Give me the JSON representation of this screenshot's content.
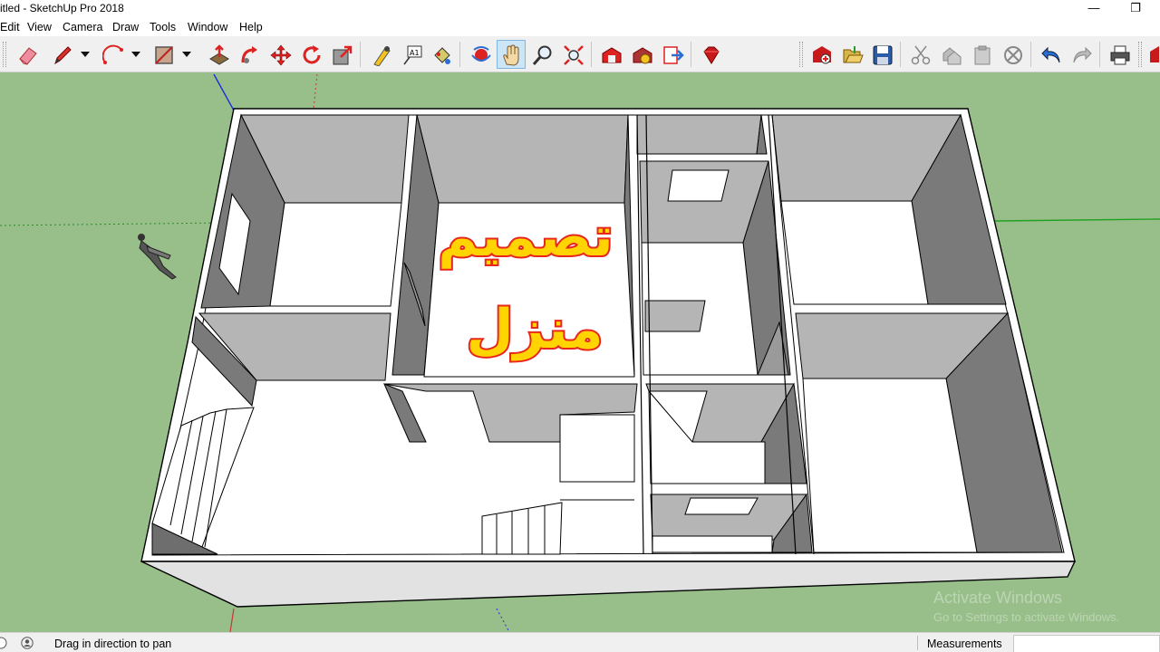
{
  "window": {
    "title": "itled - SketchUp Pro 2018",
    "minimize_glyph": "—",
    "restore_glyph": "❐"
  },
  "menu": {
    "items": [
      "Edit",
      "View",
      "Camera",
      "Draw",
      "Tools",
      "Window",
      "Help"
    ]
  },
  "toolbar": {
    "tools": [
      {
        "name": "eraser-icon"
      },
      {
        "name": "pencil-line-icon",
        "has_dropdown": true
      },
      {
        "name": "arc-icon",
        "has_dropdown": true
      },
      {
        "name": "rectangle-icon",
        "has_dropdown": true
      },
      {
        "name": "push-pull-icon"
      },
      {
        "name": "follow-me-icon"
      },
      {
        "name": "move-icon"
      },
      {
        "name": "rotate-icon"
      },
      {
        "name": "scale-icon"
      },
      {
        "name": "tape-measure-icon"
      },
      {
        "name": "text-icon",
        "label": "A1"
      },
      {
        "name": "paint-bucket-icon"
      },
      {
        "name": "orbit-icon"
      },
      {
        "name": "pan-icon",
        "active": true
      },
      {
        "name": "zoom-icon"
      },
      {
        "name": "zoom-extents-icon"
      },
      {
        "name": "warehouse-icon"
      },
      {
        "name": "extension-warehouse-icon"
      },
      {
        "name": "send-to-layout-icon"
      },
      {
        "name": "ruby-console-icon"
      },
      {
        "name": "new-file-icon"
      },
      {
        "name": "open-folder-icon"
      },
      {
        "name": "save-icon"
      },
      {
        "name": "cut-icon"
      },
      {
        "name": "copy-icon"
      },
      {
        "name": "paste-icon"
      },
      {
        "name": "erase-selection-icon"
      },
      {
        "name": "undo-icon"
      },
      {
        "name": "redo-icon"
      },
      {
        "name": "print-icon"
      },
      {
        "name": "extra-toolbar-icon"
      }
    ]
  },
  "canvas": {
    "overlay_text_line1": "تصميم",
    "overlay_text_line2": "منزل",
    "overlay_fill": "#ffd400",
    "overlay_stroke": "#e8261e",
    "ground_color": "#98bf8a",
    "watermark_title": "Activate Windows",
    "watermark_sub": "Go to Settings to activate Windows."
  },
  "status": {
    "hint": "Drag in direction to pan",
    "measurements_label": "Measurements",
    "measurements_value": ""
  }
}
